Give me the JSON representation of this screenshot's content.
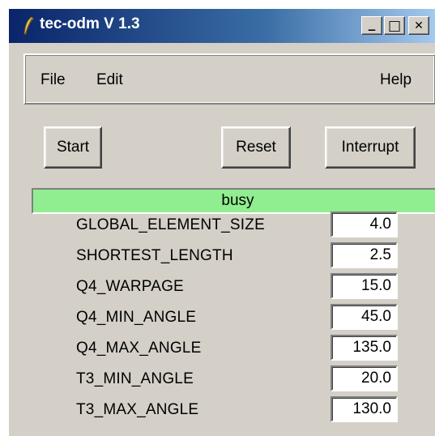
{
  "window": {
    "title": "tec-odm V 1.3",
    "title_bar_colors": [
      "#0a246a",
      "#a6caf0"
    ],
    "controls": {
      "minimize_label": "_",
      "maximize_label": "□",
      "close_label": "✕"
    }
  },
  "menu": {
    "file": "File",
    "edit": "Edit",
    "help": "Help"
  },
  "buttons": {
    "start": "Start",
    "reset": "Reset",
    "interrupt": "Interrupt"
  },
  "status": {
    "text": "busy",
    "color": "#90ee90"
  },
  "params": [
    {
      "label": "GLOBAL_ELEMENT_SIZE",
      "value": "4.0"
    },
    {
      "label": "SHORTEST_LENGTH",
      "value": "2.5"
    },
    {
      "label": "Q4_WARPAGE",
      "value": "15.0"
    },
    {
      "label": "Q4_MIN_ANGLE",
      "value": "45.0"
    },
    {
      "label": "Q4_MAX_ANGLE",
      "value": "135.0"
    },
    {
      "label": "T3_MIN_ANGLE",
      "value": "20.0"
    },
    {
      "label": "T3_MAX_ANGLE",
      "value": "130.0"
    }
  ]
}
